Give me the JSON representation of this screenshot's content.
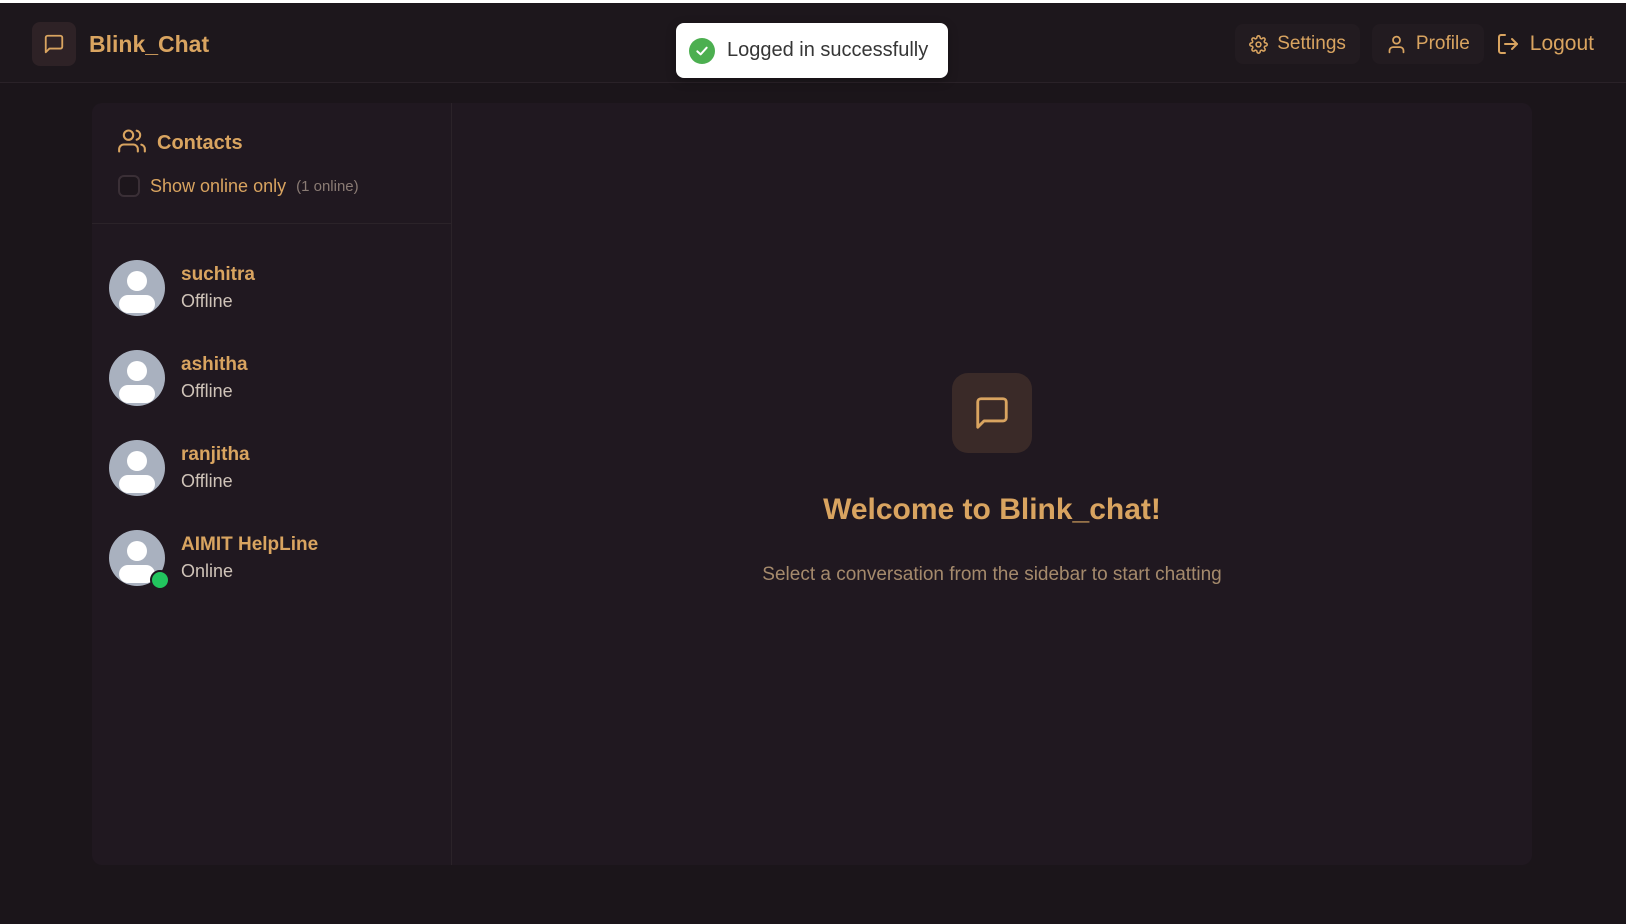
{
  "app": {
    "brand_name": "Blink_Chat",
    "accent_color": "#d9a460"
  },
  "toast": {
    "message": "Logged in successfully",
    "icon": "check-circle-icon"
  },
  "nav": {
    "settings_label": "Settings",
    "profile_label": "Profile",
    "logout_label": "Logout"
  },
  "sidebar": {
    "title": "Contacts",
    "filter_label": "Show online only",
    "online_count": "(1 online)",
    "contacts": [
      {
        "name": "suchitra",
        "status": "Offline",
        "online": false
      },
      {
        "name": "ashitha",
        "status": "Offline",
        "online": false
      },
      {
        "name": "ranjitha",
        "status": "Offline",
        "online": false
      },
      {
        "name": "AIMIT HelpLine",
        "status": "Online",
        "online": true
      }
    ]
  },
  "welcome": {
    "title": "Welcome to Blink_chat!",
    "subtitle": "Select a conversation from the sidebar to start chatting"
  }
}
